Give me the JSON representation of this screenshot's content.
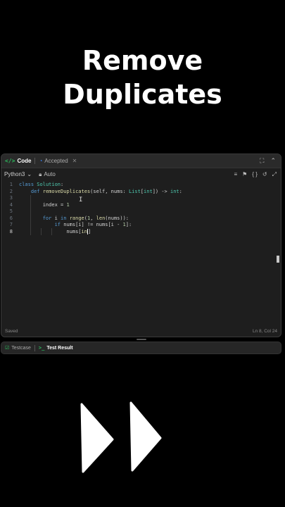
{
  "headline": {
    "line1": "Remove",
    "line2": "Duplicates"
  },
  "tabs": [
    {
      "label": "Code",
      "active": true
    },
    {
      "label": "Accepted",
      "active": false
    }
  ],
  "toolbar": {
    "language": "Python3",
    "autocomplete": "Auto"
  },
  "code_lines": [
    {
      "n": "1"
    },
    {
      "n": "2"
    },
    {
      "n": "3"
    },
    {
      "n": "4"
    },
    {
      "n": "5"
    },
    {
      "n": "6"
    },
    {
      "n": "7"
    },
    {
      "n": "8"
    }
  ],
  "status": {
    "saved": "Saved",
    "position": "Ln 8, Col 24"
  },
  "bottom_tabs": {
    "testcase": "Testcase",
    "test_result": "Test Result"
  },
  "colors": {
    "accent_green": "#2cbb5d",
    "keyword": "#569cd6",
    "function": "#dcdcaa",
    "class": "#4ec9b0"
  },
  "icons": [
    "code-icon",
    "accepted-icon",
    "lock-icon",
    "chevron-down-icon",
    "fullscreen-icon",
    "chevron-up-icon",
    "format-icon",
    "bookmark-icon",
    "braces-icon",
    "reset-icon",
    "expand-icon",
    "checkbox-icon",
    "terminal-icon",
    "fast-forward-icon"
  ]
}
